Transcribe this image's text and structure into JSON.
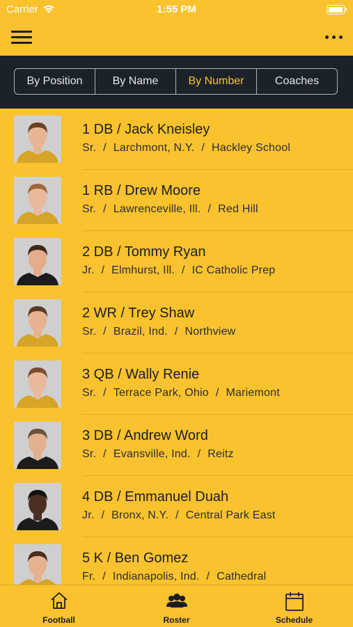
{
  "status_bar": {
    "carrier": "Carrier",
    "time": "1:55 PM"
  },
  "nav": {
    "menu_icon": "hamburger-menu-icon",
    "more_icon": "more-dots-icon"
  },
  "segments": [
    {
      "label": "By Position",
      "active": false
    },
    {
      "label": "By Name",
      "active": false
    },
    {
      "label": "By Number",
      "active": true
    },
    {
      "label": "Coaches",
      "active": false
    }
  ],
  "roster": [
    {
      "title": "1 DB / Jack Kneisley",
      "year": "Sr.",
      "hometown": "Larchmont, N.Y.",
      "school": "Hackley School",
      "hair": "#6b3f22",
      "skin": "#e8b594",
      "jersey": "#d6a427"
    },
    {
      "title": "1 RB / Drew Moore",
      "year": "Sr.",
      "hometown": "Lawrenceville, Ill.",
      "school": "Red Hill",
      "hair": "#9b6a3d",
      "skin": "#eab89a",
      "jersey": "#d6a427"
    },
    {
      "title": "2 DB / Tommy Ryan",
      "year": "Jr.",
      "hometown": "Elmhurst, Ill.",
      "school": "IC Catholic Prep",
      "hair": "#3c2718",
      "skin": "#e3ad8c",
      "jersey": "#1c1c1c"
    },
    {
      "title": "2 WR / Trey Shaw",
      "year": "Sr.",
      "hometown": "Brazil, Ind.",
      "school": "Northview",
      "hair": "#5a3a22",
      "skin": "#e6b290",
      "jersey": "#d6a427"
    },
    {
      "title": "3 QB / Wally Renie",
      "year": "Sr.",
      "hometown": "Terrace Park, Ohio",
      "school": "Mariemont",
      "hair": "#7a4e2c",
      "skin": "#eab89a",
      "jersey": "#d6a427"
    },
    {
      "title": "3 DB / Andrew Word",
      "year": "Sr.",
      "hometown": "Evansville, Ind.",
      "school": "Reitz",
      "hair": "#6e5238",
      "skin": "#e2b08e",
      "jersey": "#1c1c1c"
    },
    {
      "title": "4 DB / Emmanuel Duah",
      "year": "Jr.",
      "hometown": "Bronx, N.Y.",
      "school": "Central Park East",
      "hair": "#111111",
      "skin": "#4a3022",
      "jersey": "#1c1c1c"
    },
    {
      "title": "5 K / Ben Gomez",
      "year": "Fr.",
      "hometown": "Indianapolis, Ind.",
      "school": "Cathedral",
      "hair": "#4a2e1c",
      "skin": "#e6b290",
      "jersey": "#d6a427"
    }
  ],
  "tabs": [
    {
      "label": "Football",
      "icon": "house-icon"
    },
    {
      "label": "Roster",
      "icon": "people-icon"
    },
    {
      "label": "Schedule",
      "icon": "calendar-icon"
    }
  ]
}
